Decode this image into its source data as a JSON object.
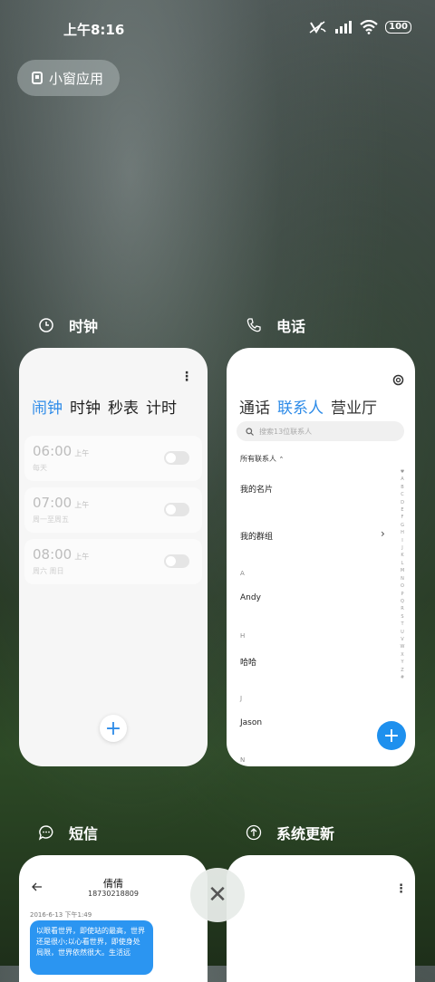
{
  "status_bar": {
    "time": "上午8:16",
    "battery": "100"
  },
  "float_button": {
    "label": "小窗应用"
  },
  "apps": {
    "clock": {
      "title": "时钟",
      "more": "⋮",
      "tabs": [
        "闹钟",
        "时钟",
        "秒表",
        "计时"
      ],
      "active_tab": 0,
      "alarms": [
        {
          "time": "06:00",
          "ampm": "上午",
          "repeat": "每天"
        },
        {
          "time": "07:00",
          "ampm": "上午",
          "repeat": "周一至周五"
        },
        {
          "time": "08:00",
          "ampm": "上午",
          "repeat": "周六 周日"
        }
      ],
      "fab": "+"
    },
    "phone": {
      "title": "电话",
      "tabs": [
        "通话",
        "联系人",
        "营业厅"
      ],
      "active_tab": 1,
      "search_placeholder": "搜索13位联系人",
      "all_contacts": "所有联系人",
      "my_card": "我的名片",
      "my_groups": "我的群组",
      "contacts": [
        {
          "letter": "A",
          "name": "Andy"
        },
        {
          "letter": "H",
          "name": "哈哈"
        },
        {
          "letter": "J",
          "name": "Jason"
        }
      ],
      "next_letter": "N",
      "alphabet": "♥\nA\nB\nC\nD\nE\nF\nG\nH\nI\nJ\nK\nL\nM\nN\nO\nP\nQ\nR\nS\nT\nU\nV\nW\nX\nY\nZ\n#",
      "fab": "+"
    },
    "messages": {
      "title": "短信",
      "contact_name": "倩倩",
      "contact_number": "18730218809",
      "date": "2016-6-13 下午1:49",
      "bubble_text": "以眼看世界，即使站的最高，世界还是很小;以心看世界，即使身处局限，世界依然很大。生活远"
    },
    "updater": {
      "title": "系统更新",
      "more": "⋮"
    }
  },
  "close_button": "✕"
}
